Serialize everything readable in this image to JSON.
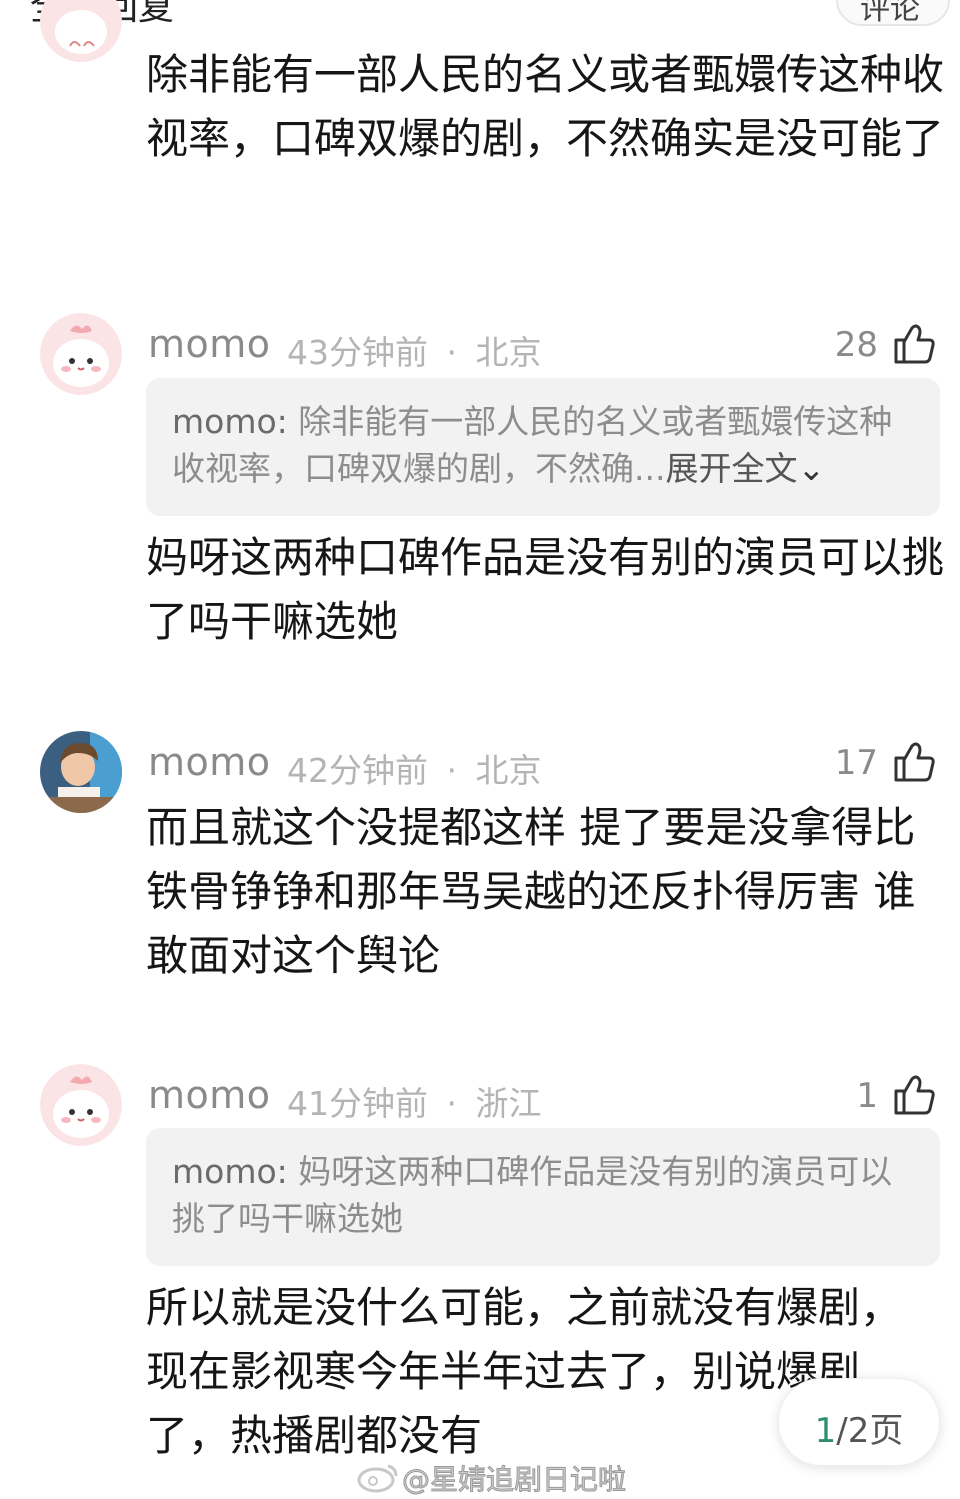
{
  "header": {
    "title_partial": "全部回复",
    "button_partial": "评论"
  },
  "comments": [
    {
      "body": "除非能有一部人民的名义或者甄嬛传这种收视率，口碑双爆的剧，不然确实是没可能了"
    },
    {
      "username": "momo",
      "time": "43分钟前",
      "separator": "·",
      "location": "北京",
      "likes": "28",
      "quote_user": "momo:",
      "quote_text": " 除非能有一部人民的名义或者甄嬛传这种收视率，口碑双爆的剧，不然确...",
      "quote_expand": "展开全文",
      "body": "妈呀这两种口碑作品是没有别的演员可以挑了吗干嘛选她"
    },
    {
      "username": "momo",
      "time": "42分钟前",
      "separator": "·",
      "location": "北京",
      "likes": "17",
      "body": "而且就这个没提都这样 提了要是没拿得比铁骨铮铮和那年骂吴越的还反扑得厉害 谁敢面对这个舆论"
    },
    {
      "username": "momo",
      "time": "41分钟前",
      "separator": "·",
      "location": "浙江",
      "likes": "1",
      "quote_user": "momo:",
      "quote_text": " 妈呀这两种口碑作品是没有别的演员可以挑了吗干嘛选她",
      "body": "所以就是没什么可能，之前就没有爆剧，现在影视寒今年半年过去了，别说爆剧了，热播剧都没有"
    }
  ],
  "pager": {
    "current": "1",
    "total": "/2页"
  },
  "watermark": "@星婧追剧日记啦",
  "colors": {
    "accent_green": "#2f8f6a",
    "quote_bg": "#f2f2f2",
    "meta_gray": "#b4b4b4"
  }
}
